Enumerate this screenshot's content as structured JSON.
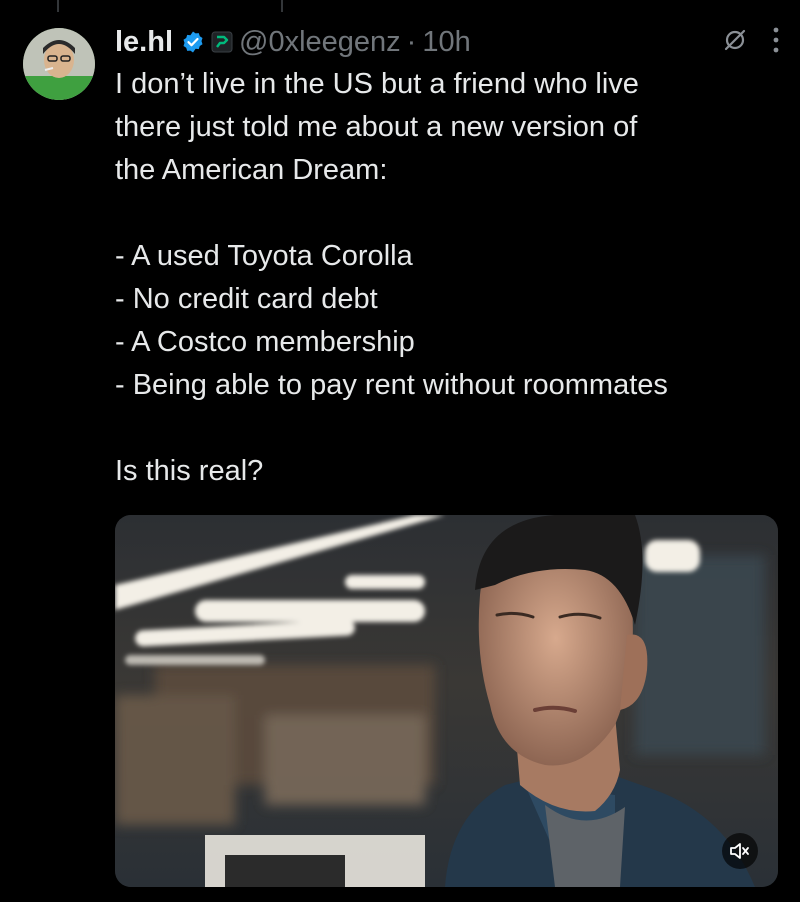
{
  "tweet": {
    "author_name": "le.hl",
    "handle": "@0xleegenz",
    "separator": "·",
    "time": "10h",
    "lines_intro": [
      "I don’t live in the US but a friend who live",
      "there just told me about a new version of",
      "the American Dream:"
    ],
    "list_items": [
      "- A used Toyota Corolla",
      "- No credit card debt",
      "- A Costco membership",
      "- Being able to pay rent without roommates"
    ],
    "question": "Is this real?"
  },
  "icons": {
    "verified": "verified-badge-icon",
    "affiliate": "affiliate-badge-icon",
    "grok": "grok-icon",
    "more": "more-options-icon",
    "mute": "volume-muted-icon"
  },
  "colors": {
    "background": "#000000",
    "text": "#e7e9ea",
    "secondary": "#71767b",
    "verified_blue": "#1d9bf0",
    "affiliate_green": "#00ba7c"
  }
}
